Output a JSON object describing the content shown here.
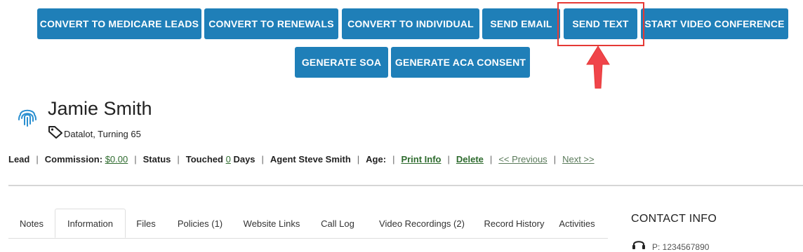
{
  "actions": {
    "convert_medicare": "CONVERT TO MEDICARE LEADS",
    "convert_renewals": "CONVERT TO RENEWALS",
    "convert_individual": "CONVERT TO INDIVIDUAL",
    "send_email": "SEND EMAIL",
    "send_text": "SEND TEXT",
    "start_video": "START VIDEO CONFERENCE",
    "generate_soa": "GENERATE SOA",
    "generate_aca": "GENERATE ACA CONSENT"
  },
  "lead": {
    "name": "Jamie Smith",
    "tags": "Datalot, Turning 65"
  },
  "info": {
    "type": "Lead",
    "commission_label": "Commission:",
    "commission_value": "$0.00",
    "status_label": "Status",
    "touched_label": "Touched",
    "touched_value": "0",
    "touched_unit": "Days",
    "agent": "Agent Steve Smith",
    "age_label": "Age:",
    "print_info": "Print Info",
    "delete": "Delete",
    "previous": "<< Previous",
    "next": "Next >>"
  },
  "tabs": [
    "Notes",
    "Information",
    "Files",
    "Policies (1)",
    "Website Links",
    "Call Log",
    "Video Recordings (2)",
    "Record History",
    "Activities"
  ],
  "active_tab": "Information",
  "contact": {
    "title": "CONTACT INFO",
    "phone": "P: 1234567890"
  },
  "colors": {
    "button": "#1f7fb8",
    "highlight": "#e53935",
    "link": "#2e6b2e"
  }
}
